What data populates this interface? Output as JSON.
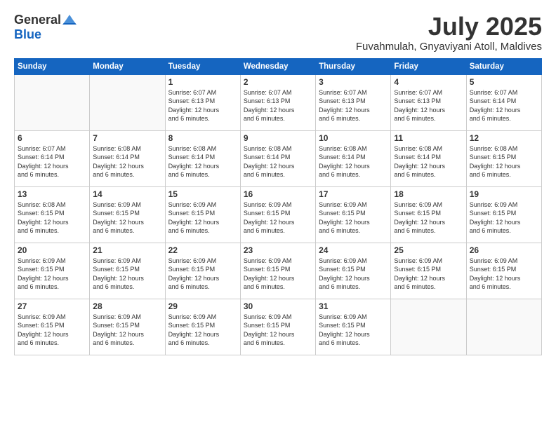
{
  "header": {
    "logo": {
      "general": "General",
      "blue": "Blue"
    },
    "title": "July 2025",
    "location": "Fuvahmulah, Gnyaviyani Atoll, Maldives"
  },
  "weekdays": [
    "Sunday",
    "Monday",
    "Tuesday",
    "Wednesday",
    "Thursday",
    "Friday",
    "Saturday"
  ],
  "weeks": [
    [
      {
        "day": "",
        "info": ""
      },
      {
        "day": "",
        "info": ""
      },
      {
        "day": "1",
        "info": "Sunrise: 6:07 AM\nSunset: 6:13 PM\nDaylight: 12 hours\nand 6 minutes."
      },
      {
        "day": "2",
        "info": "Sunrise: 6:07 AM\nSunset: 6:13 PM\nDaylight: 12 hours\nand 6 minutes."
      },
      {
        "day": "3",
        "info": "Sunrise: 6:07 AM\nSunset: 6:13 PM\nDaylight: 12 hours\nand 6 minutes."
      },
      {
        "day": "4",
        "info": "Sunrise: 6:07 AM\nSunset: 6:13 PM\nDaylight: 12 hours\nand 6 minutes."
      },
      {
        "day": "5",
        "info": "Sunrise: 6:07 AM\nSunset: 6:14 PM\nDaylight: 12 hours\nand 6 minutes."
      }
    ],
    [
      {
        "day": "6",
        "info": "Sunrise: 6:07 AM\nSunset: 6:14 PM\nDaylight: 12 hours\nand 6 minutes."
      },
      {
        "day": "7",
        "info": "Sunrise: 6:08 AM\nSunset: 6:14 PM\nDaylight: 12 hours\nand 6 minutes."
      },
      {
        "day": "8",
        "info": "Sunrise: 6:08 AM\nSunset: 6:14 PM\nDaylight: 12 hours\nand 6 minutes."
      },
      {
        "day": "9",
        "info": "Sunrise: 6:08 AM\nSunset: 6:14 PM\nDaylight: 12 hours\nand 6 minutes."
      },
      {
        "day": "10",
        "info": "Sunrise: 6:08 AM\nSunset: 6:14 PM\nDaylight: 12 hours\nand 6 minutes."
      },
      {
        "day": "11",
        "info": "Sunrise: 6:08 AM\nSunset: 6:14 PM\nDaylight: 12 hours\nand 6 minutes."
      },
      {
        "day": "12",
        "info": "Sunrise: 6:08 AM\nSunset: 6:15 PM\nDaylight: 12 hours\nand 6 minutes."
      }
    ],
    [
      {
        "day": "13",
        "info": "Sunrise: 6:08 AM\nSunset: 6:15 PM\nDaylight: 12 hours\nand 6 minutes."
      },
      {
        "day": "14",
        "info": "Sunrise: 6:09 AM\nSunset: 6:15 PM\nDaylight: 12 hours\nand 6 minutes."
      },
      {
        "day": "15",
        "info": "Sunrise: 6:09 AM\nSunset: 6:15 PM\nDaylight: 12 hours\nand 6 minutes."
      },
      {
        "day": "16",
        "info": "Sunrise: 6:09 AM\nSunset: 6:15 PM\nDaylight: 12 hours\nand 6 minutes."
      },
      {
        "day": "17",
        "info": "Sunrise: 6:09 AM\nSunset: 6:15 PM\nDaylight: 12 hours\nand 6 minutes."
      },
      {
        "day": "18",
        "info": "Sunrise: 6:09 AM\nSunset: 6:15 PM\nDaylight: 12 hours\nand 6 minutes."
      },
      {
        "day": "19",
        "info": "Sunrise: 6:09 AM\nSunset: 6:15 PM\nDaylight: 12 hours\nand 6 minutes."
      }
    ],
    [
      {
        "day": "20",
        "info": "Sunrise: 6:09 AM\nSunset: 6:15 PM\nDaylight: 12 hours\nand 6 minutes."
      },
      {
        "day": "21",
        "info": "Sunrise: 6:09 AM\nSunset: 6:15 PM\nDaylight: 12 hours\nand 6 minutes."
      },
      {
        "day": "22",
        "info": "Sunrise: 6:09 AM\nSunset: 6:15 PM\nDaylight: 12 hours\nand 6 minutes."
      },
      {
        "day": "23",
        "info": "Sunrise: 6:09 AM\nSunset: 6:15 PM\nDaylight: 12 hours\nand 6 minutes."
      },
      {
        "day": "24",
        "info": "Sunrise: 6:09 AM\nSunset: 6:15 PM\nDaylight: 12 hours\nand 6 minutes."
      },
      {
        "day": "25",
        "info": "Sunrise: 6:09 AM\nSunset: 6:15 PM\nDaylight: 12 hours\nand 6 minutes."
      },
      {
        "day": "26",
        "info": "Sunrise: 6:09 AM\nSunset: 6:15 PM\nDaylight: 12 hours\nand 6 minutes."
      }
    ],
    [
      {
        "day": "27",
        "info": "Sunrise: 6:09 AM\nSunset: 6:15 PM\nDaylight: 12 hours\nand 6 minutes."
      },
      {
        "day": "28",
        "info": "Sunrise: 6:09 AM\nSunset: 6:15 PM\nDaylight: 12 hours\nand 6 minutes."
      },
      {
        "day": "29",
        "info": "Sunrise: 6:09 AM\nSunset: 6:15 PM\nDaylight: 12 hours\nand 6 minutes."
      },
      {
        "day": "30",
        "info": "Sunrise: 6:09 AM\nSunset: 6:15 PM\nDaylight: 12 hours\nand 6 minutes."
      },
      {
        "day": "31",
        "info": "Sunrise: 6:09 AM\nSunset: 6:15 PM\nDaylight: 12 hours\nand 6 minutes."
      },
      {
        "day": "",
        "info": ""
      },
      {
        "day": "",
        "info": ""
      }
    ]
  ]
}
